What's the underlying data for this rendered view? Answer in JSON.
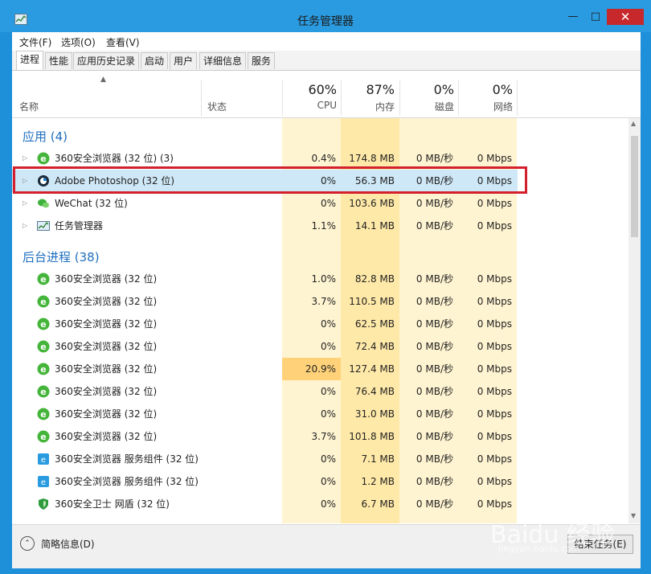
{
  "window": {
    "title": "任务管理器"
  },
  "menu": [
    "文件(F)",
    "选项(O)",
    "查看(V)"
  ],
  "tabs": [
    "进程",
    "性能",
    "应用历史记录",
    "启动",
    "用户",
    "详细信息",
    "服务"
  ],
  "header": {
    "name": "名称",
    "status": "状态",
    "cpu_pct": "60%",
    "cpu": "CPU",
    "mem_pct": "87%",
    "mem": "内存",
    "disk_pct": "0%",
    "disk": "磁盘",
    "net_pct": "0%",
    "net": "网络"
  },
  "groups": {
    "apps": "应用 (4)",
    "background": "后台进程 (38)"
  },
  "apps": [
    {
      "name": "360安全浏览器 (32 位) (3)",
      "cpu": "0.4%",
      "mem": "174.8 MB",
      "disk": "0 MB/秒",
      "net": "0 Mbps",
      "icon": "360-browser-icon"
    },
    {
      "name": "Adobe Photoshop (32 位)",
      "cpu": "0%",
      "mem": "56.3 MB",
      "disk": "0 MB/秒",
      "net": "0 Mbps",
      "icon": "photoshop-icon"
    },
    {
      "name": "WeChat (32 位)",
      "cpu": "0%",
      "mem": "103.6 MB",
      "disk": "0 MB/秒",
      "net": "0 Mbps",
      "icon": "wechat-icon"
    },
    {
      "name": "任务管理器",
      "cpu": "1.1%",
      "mem": "14.1 MB",
      "disk": "0 MB/秒",
      "net": "0 Mbps",
      "icon": "task-manager-icon"
    }
  ],
  "background": [
    {
      "name": "360安全浏览器 (32 位)",
      "cpu": "1.0%",
      "mem": "82.8 MB",
      "disk": "0 MB/秒",
      "net": "0 Mbps"
    },
    {
      "name": "360安全浏览器 (32 位)",
      "cpu": "3.7%",
      "mem": "110.5 MB",
      "disk": "0 MB/秒",
      "net": "0 Mbps"
    },
    {
      "name": "360安全浏览器 (32 位)",
      "cpu": "0%",
      "mem": "62.5 MB",
      "disk": "0 MB/秒",
      "net": "0 Mbps"
    },
    {
      "name": "360安全浏览器 (32 位)",
      "cpu": "0%",
      "mem": "72.4 MB",
      "disk": "0 MB/秒",
      "net": "0 Mbps"
    },
    {
      "name": "360安全浏览器 (32 位)",
      "cpu": "20.9%",
      "mem": "127.4 MB",
      "disk": "0 MB/秒",
      "net": "0 Mbps"
    },
    {
      "name": "360安全浏览器 (32 位)",
      "cpu": "0%",
      "mem": "76.4 MB",
      "disk": "0 MB/秒",
      "net": "0 Mbps"
    },
    {
      "name": "360安全浏览器 (32 位)",
      "cpu": "0%",
      "mem": "31.0 MB",
      "disk": "0 MB/秒",
      "net": "0 Mbps"
    },
    {
      "name": "360安全浏览器 (32 位)",
      "cpu": "3.7%",
      "mem": "101.8 MB",
      "disk": "0 MB/秒",
      "net": "0 Mbps"
    },
    {
      "name": "360安全浏览器 服务组件 (32 位)",
      "cpu": "0%",
      "mem": "7.1 MB",
      "disk": "0 MB/秒",
      "net": "0 Mbps"
    },
    {
      "name": "360安全浏览器 服务组件 (32 位)",
      "cpu": "0%",
      "mem": "1.2 MB",
      "disk": "0 MB/秒",
      "net": "0 Mbps"
    },
    {
      "name": "360安全卫士 网盾 (32 位)",
      "cpu": "0%",
      "mem": "6.7 MB",
      "disk": "0 MB/秒",
      "net": "0 Mbps"
    }
  ],
  "footer": {
    "fewer_details": "简略信息(D)",
    "end_task": "结束任务(E)"
  },
  "watermark": {
    "main": "Baidu 经验",
    "sub": "jingyan.baidu.com"
  },
  "colors": {
    "accent": "#2a9be0",
    "close": "#c7282b",
    "highlight_box": "#d41f2c",
    "group_text": "#1f6fbf"
  }
}
